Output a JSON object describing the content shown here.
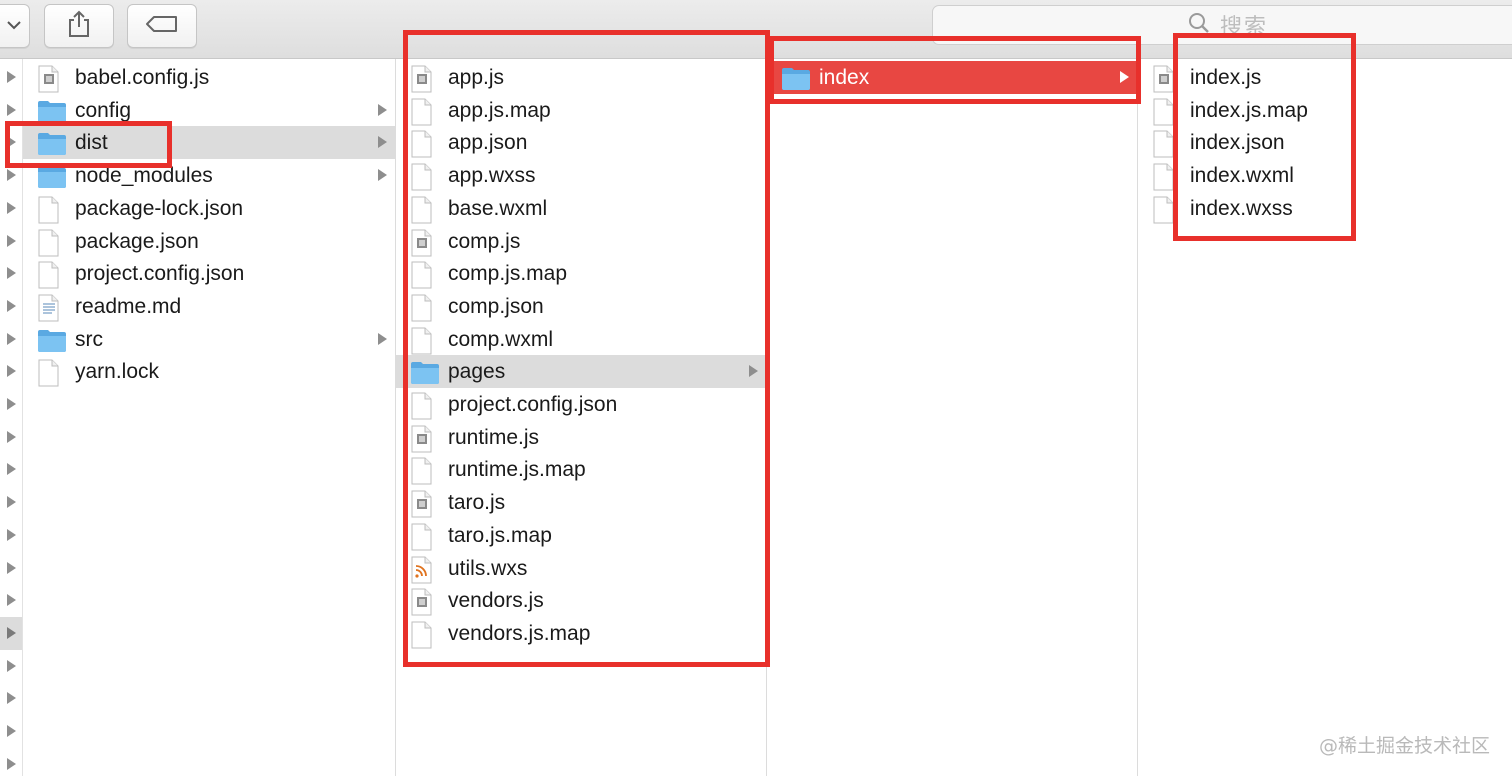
{
  "toolbar": {
    "search_placeholder": "搜索"
  },
  "columns": [
    {
      "items": [
        {
          "name": "babel.config.js",
          "type": "file-js",
          "folder": false
        },
        {
          "name": "config",
          "type": "folder",
          "folder": true
        },
        {
          "name": "dist",
          "type": "folder",
          "folder": true,
          "selected": "inactive"
        },
        {
          "name": "node_modules",
          "type": "folder",
          "folder": true
        },
        {
          "name": "package-lock.json",
          "type": "file",
          "folder": false
        },
        {
          "name": "package.json",
          "type": "file",
          "folder": false
        },
        {
          "name": "project.config.json",
          "type": "file",
          "folder": false
        },
        {
          "name": "readme.md",
          "type": "file-text",
          "folder": false
        },
        {
          "name": "src",
          "type": "folder",
          "folder": true
        },
        {
          "name": "yarn.lock",
          "type": "file",
          "folder": false
        }
      ]
    },
    {
      "items": [
        {
          "name": "app.js",
          "type": "file-js",
          "folder": false
        },
        {
          "name": "app.js.map",
          "type": "file",
          "folder": false
        },
        {
          "name": "app.json",
          "type": "file",
          "folder": false
        },
        {
          "name": "app.wxss",
          "type": "file",
          "folder": false
        },
        {
          "name": "base.wxml",
          "type": "file",
          "folder": false
        },
        {
          "name": "comp.js",
          "type": "file-js",
          "folder": false
        },
        {
          "name": "comp.js.map",
          "type": "file",
          "folder": false
        },
        {
          "name": "comp.json",
          "type": "file",
          "folder": false
        },
        {
          "name": "comp.wxml",
          "type": "file",
          "folder": false
        },
        {
          "name": "pages",
          "type": "folder",
          "folder": true,
          "selected": "inactive"
        },
        {
          "name": "project.config.json",
          "type": "file",
          "folder": false
        },
        {
          "name": "runtime.js",
          "type": "file-js",
          "folder": false
        },
        {
          "name": "runtime.js.map",
          "type": "file",
          "folder": false
        },
        {
          "name": "taro.js",
          "type": "file-js",
          "folder": false
        },
        {
          "name": "taro.js.map",
          "type": "file",
          "folder": false
        },
        {
          "name": "utils.wxs",
          "type": "file-rss",
          "folder": false
        },
        {
          "name": "vendors.js",
          "type": "file-js",
          "folder": false
        },
        {
          "name": "vendors.js.map",
          "type": "file",
          "folder": false
        }
      ]
    },
    {
      "items": [
        {
          "name": "index",
          "type": "folder",
          "folder": true,
          "selected": "active"
        }
      ]
    },
    {
      "items": [
        {
          "name": "index.js",
          "type": "file-js",
          "folder": false
        },
        {
          "name": "index.js.map",
          "type": "file",
          "folder": false
        },
        {
          "name": "index.json",
          "type": "file",
          "folder": false
        },
        {
          "name": "index.wxml",
          "type": "file",
          "folder": false
        },
        {
          "name": "index.wxss",
          "type": "file",
          "folder": false
        }
      ]
    }
  ],
  "colors": {
    "highlight_active": "#e84742",
    "highlight_inactive": "#dcdcdc",
    "annotation_box": "#e8302b",
    "folder_blue": "#6cb9ec"
  },
  "watermark": "@稀土掘金技术社区"
}
